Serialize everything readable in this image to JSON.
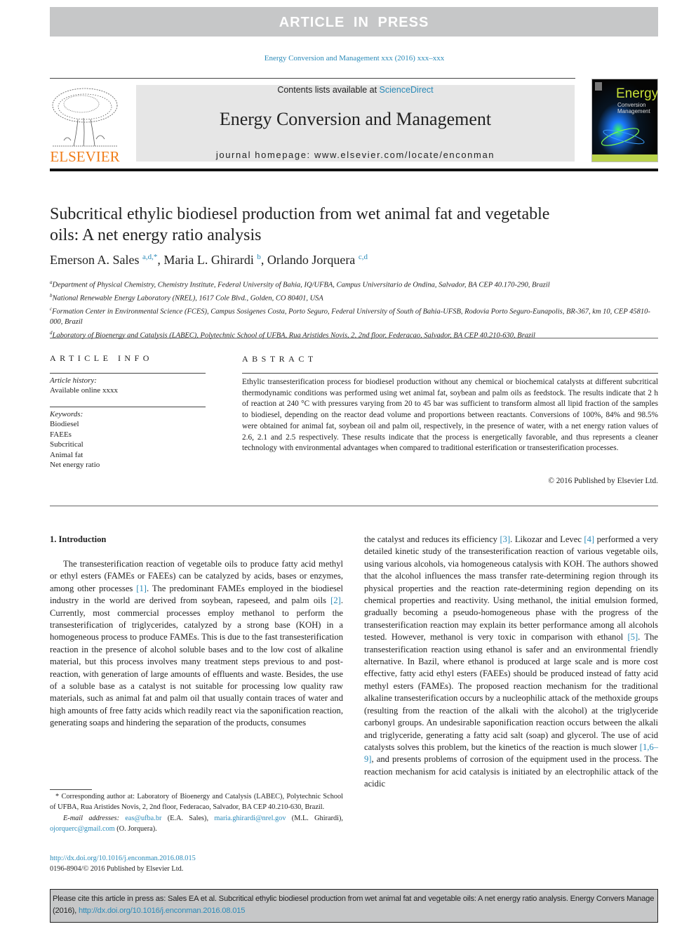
{
  "banner": "ARTICLE IN PRESS",
  "journal_ref": "Energy Conversion and Management xxx (2016) xxx–xxx",
  "masthead": {
    "contents_prefix": "Contents lists available at ",
    "contents_link": "ScienceDirect",
    "journal_title": "Energy Conversion and Management",
    "homepage": "journal homepage: www.elsevier.com/locate/enconman",
    "publisher_logo": "ELSEVIER",
    "cover": {
      "title": "Energy",
      "subtitle_1": "Conversion",
      "subtitle_2": "Management"
    }
  },
  "article": {
    "title": "Subcritical ethylic biodiesel production from wet animal fat and vegetable oils: A net energy ratio analysis",
    "authors": [
      {
        "name": "Emerson A. Sales",
        "sup": "a,d,*",
        "sep": ", "
      },
      {
        "name": "Maria L. Ghirardi",
        "sup": "b",
        "sep": ", "
      },
      {
        "name": "Orlando Jorquera",
        "sup": "c,d",
        "sep": ""
      }
    ],
    "affiliations": [
      {
        "key": "a",
        "text": "Department of Physical Chemistry, Chemistry Institute, Federal University of Bahia, IQ/UFBA, Campus Universitario de Ondina, Salvador, BA CEP 40.170-290, Brazil"
      },
      {
        "key": "b",
        "text": "National Renewable Energy Laboratory (NREL), 1617 Cole Blvd., Golden, CO 80401, USA"
      },
      {
        "key": "c",
        "text": "Formation Center in Environmental Science (FCES), Campus Sosigenes Costa, Porto Seguro, Federal University of South of Bahia-UFSB, Rodovia Porto Seguro-Eunapolis, BR-367, km 10, CEP 45810-000, Brazil"
      },
      {
        "key": "d",
        "text": "Laboratory of Bioenergy and Catalysis (LABEC), Polytechnic School of UFBA, Rua Aristides Novis, 2, 2nd floor, Federacao, Salvador, BA CEP 40.210-630, Brazil"
      }
    ]
  },
  "article_info": {
    "heading": "ARTICLE INFO",
    "history_label": "Article history:",
    "history_value": "Available online xxxx",
    "keywords_label": "Keywords:",
    "keywords": [
      "Biodiesel",
      "FAEEs",
      "Subcritical",
      "Animal fat",
      "Net energy ratio"
    ]
  },
  "abstract": {
    "heading": "ABSTRACT",
    "text": "Ethylic transesterification process for biodiesel production without any chemical or biochemical catalysts at different subcritical thermodynamic conditions was performed using wet animal fat, soybean and palm oils as feedstock. The results indicate that 2 h of reaction at 240 °C with pressures varying from 20 to 45 bar was sufficient to transform almost all lipid fraction of the samples to biodiesel, depending on the reactor dead volume and proportions between reactants. Conversions of 100%, 84% and 98.5% were obtained for animal fat, soybean oil and palm oil, respectively, in the presence of water, with a net energy ration values of 2.6, 2.1 and 2.5 respectively. These results indicate that the process is energetically favorable, and thus represents a cleaner technology with environmental advantages when compared to traditional esterification or transesterification processes.",
    "copyright": "© 2016 Published by Elsevier Ltd."
  },
  "intro": {
    "heading": "1. Introduction",
    "left": [
      {
        "t": "The transesterification reaction of vegetable oils to produce fatty acid methyl or ethyl esters (FAMEs or FAEEs) can be catalyzed by acids, bases or enzymes, among other processes "
      },
      {
        "ref": "[1]"
      },
      {
        "t": ". The predominant FAMEs employed in the biodiesel industry in the world are derived from soybean, rapeseed, and palm oils "
      },
      {
        "ref": "[2]"
      },
      {
        "t": ". Currently, most commercial processes employ methanol to perform the transesterification of triglycerides, catalyzed by a strong base (KOH) in a homogeneous process to produce FAMEs. This is due to the fast transesterification reaction in the presence of alcohol soluble bases and to the low cost of alkaline material, but this process involves many treatment steps previous to and post-reaction, with generation of large amounts of effluents and waste. Besides, the use of a soluble base as a catalyst is not suitable for processing low quality raw materials, such as animal fat and palm oil that usually contain traces of water and high amounts of free fatty acids which readily react via the saponification reaction, generating soaps and hindering the separation of the products, consumes"
      }
    ],
    "right": [
      {
        "t": "the catalyst and reduces its efficiency "
      },
      {
        "ref": "[3]"
      },
      {
        "t": ". Likozar and Levec "
      },
      {
        "ref": "[4]"
      },
      {
        "t": " performed a very detailed kinetic study of the transesterification reaction of various vegetable oils, using various alcohols, via homogeneous catalysis with KOH. The authors showed that the alcohol influences the mass transfer rate-determining region through its physical properties and the reaction rate-determining region depending on its chemical properties and reactivity. Using methanol, the initial emulsion formed, gradually becoming a pseudo-homogeneous phase with the progress of the transesterification reaction may explain its better performance among all alcohols tested. However, methanol is very toxic in comparison with ethanol "
      },
      {
        "ref": "[5]"
      },
      {
        "t": ". The transesterification reaction using ethanol is safer and an environmental friendly alternative. In Bazil, where ethanol is produced at large scale and is more cost effective, fatty acid ethyl esters (FAEEs) should be produced instead of fatty acid methyl esters (FAMEs). The proposed reaction mechanism for the traditional alkaline transesterification occurs by a nucleophilic attack of the methoxide groups (resulting from the reaction of the alkali with the alcohol) at the triglyceride carbonyl groups. An undesirable saponification reaction occurs between the alkali and triglyceride, generating a fatty acid salt (soap) and glycerol. The use of acid catalysts solves this problem, but the kinetics of the reaction is much slower "
      },
      {
        "ref": "[1,6–9]"
      },
      {
        "t": ", and presents problems of corrosion of the equipment used in the process. The reaction mechanism for acid catalysis is initiated by an electrophilic attack of the acidic"
      }
    ]
  },
  "footnote": {
    "corresponding": "* Corresponding author at: Laboratory of Bioenergy and Catalysis (LABEC), Polytechnic School of UFBA, Rua Aristides Novis, 2, 2nd floor, Federacao, Salvador, BA CEP 40.210-630, Brazil.",
    "email_label": "E-mail addresses:",
    "emails": [
      {
        "addr": "eas@ufba.br",
        "who": " (E.A. Sales), "
      },
      {
        "addr": "maria.ghirardi@nrel.gov",
        "who": " (M.L. Ghirardi), "
      },
      {
        "addr": "ojorquerc@gmail.com",
        "who": " (O. Jorquera)."
      }
    ],
    "doi": "http://dx.doi.org/10.1016/j.enconman.2016.08.015",
    "issn": "0196-8904/© 2016 Published by Elsevier Ltd."
  },
  "cite_box": {
    "text": "Please cite this article in press as: Sales EA et al. Subcritical ethylic biodiesel production from wet animal fat and vegetable oils: A net energy ratio analysis. Energy Convers Manage (2016), ",
    "link": "http://dx.doi.org/10.1016/j.enconman.2016.08.015"
  },
  "colors": {
    "link": "#2a8ab8",
    "banner": "#c6c7c8",
    "elsevier_orange": "#f07d1a"
  }
}
